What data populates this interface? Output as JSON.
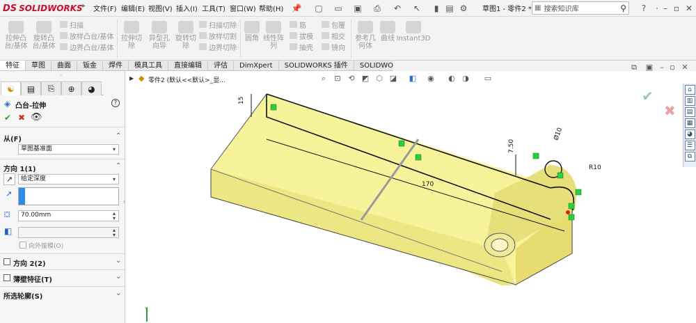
{
  "app": {
    "logo_text": "SOLIDWORKS",
    "logo_mark": "DS"
  },
  "menu": [
    "文件(F)",
    "编辑(E)",
    "视图(V)",
    "插入(I)",
    "工具(T)",
    "窗口(W)",
    "帮助(H)"
  ],
  "doc_title": "草图1 - 零件2 *",
  "search": {
    "placeholder": "搜索知识库"
  },
  "top_right_icons": [
    "search-icon",
    "help-icon",
    "user-icon",
    "minimize-icon",
    "restore-icon",
    "close-icon"
  ],
  "ribbon": {
    "extrude_boss": "拉伸凸\n台/基体",
    "revolve_boss": "旋转凸\n台/基体",
    "sweep": "扫描",
    "loft": "放样凸台/基体",
    "boundary": "边界凸台/基体",
    "extrude_cut": "拉伸切\n除",
    "hole_wizard": "异型孔\n向导",
    "revolve_cut": "旋转切\n除",
    "sweep_cut": "扫描切除",
    "loft_cut": "放样切割",
    "boundary_cut": "边界切除",
    "fillet": "圆角",
    "linear_pattern": "线性阵\n列",
    "rib": "筋",
    "draft": "拔模",
    "shell": "抽壳",
    "wrap": "包覆",
    "intersect": "相交",
    "mirror": "镜向",
    "ref_geometry": "参考几\n何体",
    "curves": "曲线",
    "instant3d": "Instant3D"
  },
  "tabs": [
    "特征",
    "草图",
    "曲面",
    "钣金",
    "焊件",
    "模具工具",
    "直接编辑",
    "评估",
    "DimXpert",
    "SOLIDWORKS 插件",
    "SOLIDWORKS MBD"
  ],
  "active_tab": "特征",
  "feature_tree_label": "零件2 (默认<<默认>_显...",
  "panel": {
    "title": "凸台-拉伸",
    "from_header": "从(F)",
    "from_value": "草图基准面",
    "dir1_header": "方向 1(1)",
    "dir1_type": "给定深度",
    "depth": "70.00mm",
    "draft_outward": "向外拔模(O)",
    "dir2_header": "方向 2(2)",
    "thin_header": "薄壁特征(T)",
    "contours_header": "所选轮廓(S)"
  },
  "drawing": {
    "dim_length": "170",
    "dim_height": "15",
    "dim_offset": "7.50",
    "dim_diameter": "Ø10",
    "dim_radius": "R10"
  },
  "colors": {
    "brand": "#c8102e",
    "body_face": "#f7f39a",
    "body_side": "#e9e37a",
    "edge": "#222222",
    "relation_badge": "#2ecc40"
  }
}
